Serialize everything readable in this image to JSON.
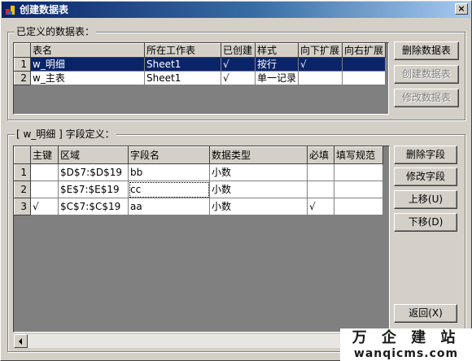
{
  "window": {
    "title": "创建数据表",
    "close_glyph": "×"
  },
  "tables_group": {
    "label": "已定义的数据表：",
    "headers": [
      "",
      "表名",
      "所在工作表",
      "已创建",
      "样式",
      "向下扩展",
      "向右扩展"
    ],
    "rows": [
      {
        "num": "1",
        "name": "w_明细",
        "sheet": "Sheet1",
        "created": "√",
        "style": "按行",
        "down": "√",
        "right": ""
      },
      {
        "num": "2",
        "name": "w_主表",
        "sheet": "Sheet1",
        "created": "√",
        "style": "单一记录",
        "down": "",
        "right": ""
      }
    ],
    "buttons": {
      "delete": "删除数据表",
      "create": "创建数据表",
      "modify": "修改数据表"
    }
  },
  "fields_group": {
    "label": "[ w_明细 ] 字段定义：",
    "headers": [
      "",
      "主键",
      "区域",
      "字段名",
      "数据类型",
      "必填",
      "填写规范"
    ],
    "rows": [
      {
        "num": "1",
        "pk": "",
        "range": "$D$7:$D$19",
        "field": "bb",
        "type": "小数",
        "required": "",
        "rule": ""
      },
      {
        "num": "2",
        "pk": "",
        "range": "$E$7:$E$19",
        "field": "cc",
        "type": "小数",
        "required": "",
        "rule": ""
      },
      {
        "num": "3",
        "pk": "√",
        "range": "$C$7:$C$19",
        "field": "aa",
        "type": "小数",
        "required": "√",
        "rule": ""
      }
    ],
    "buttons": {
      "delete": "删除字段",
      "modify": "修改字段",
      "up": "上移(U)",
      "down": "下移(D)",
      "back": "返回(X)"
    }
  },
  "watermark": {
    "chinese": "万 企 建 站",
    "domain": "wanqicms.com"
  }
}
